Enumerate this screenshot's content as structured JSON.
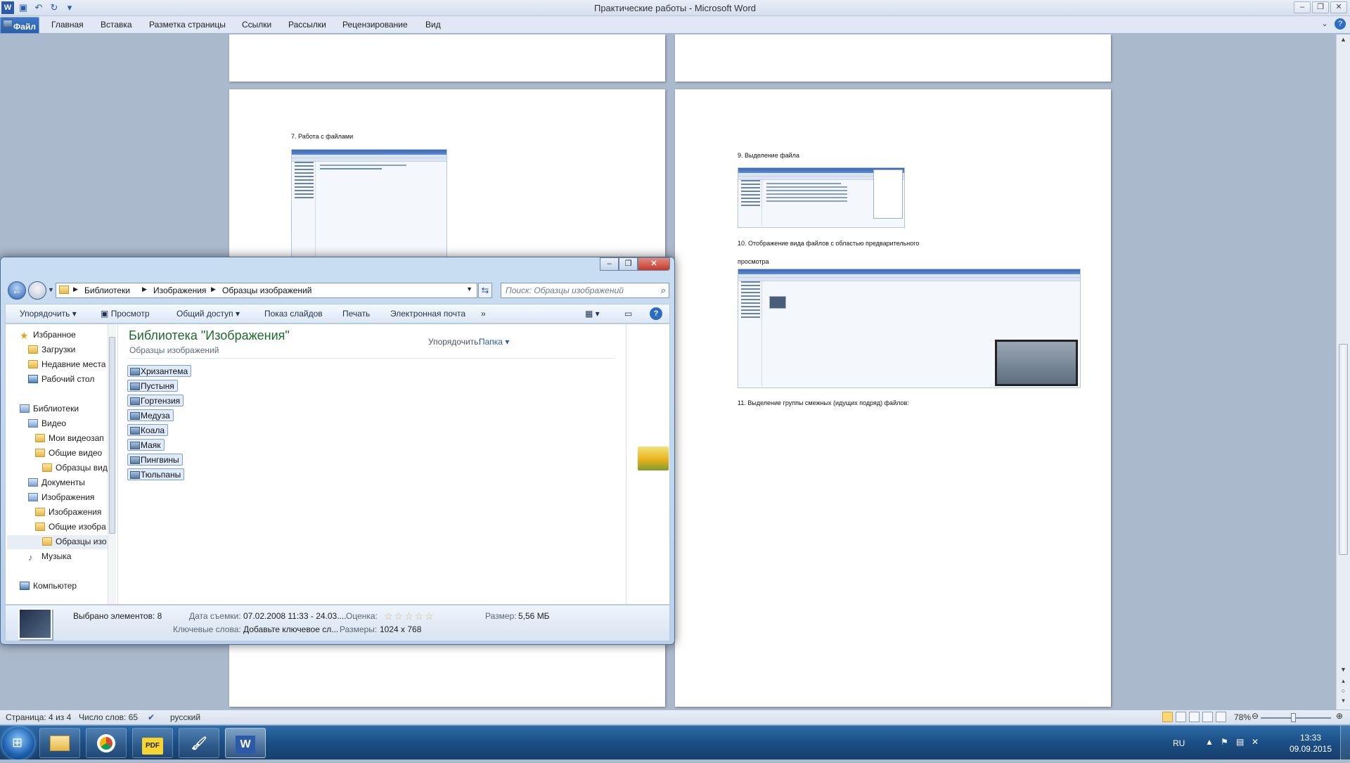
{
  "word": {
    "window_title": "Практические  работы  -  Microsoft Word",
    "file_tab": "Файл",
    "tabs": [
      "Главная",
      "Вставка",
      "Разметка страницы",
      "Ссылки",
      "Рассылки",
      "Рецензирование",
      "Вид"
    ]
  },
  "document": {
    "left_page": {
      "heading": "7. Работа с файлами"
    },
    "right_page": {
      "item9": "9. Выделение файла",
      "item10_line1": "10. Отображение вида файлов с областью предварительного",
      "item10_line2": "просмотра",
      "item11": "11. Выделение группы смежных (идущих подряд) файлов:"
    }
  },
  "statusbar": {
    "page": "Страница: 4 из 4",
    "words": "Число слов: 65",
    "language": "русский",
    "zoom": "78%",
    "zoom_level": 0.78
  },
  "explorer": {
    "breadcrumbs": [
      "Библиотеки",
      "Изображения",
      "Образцы изображений"
    ],
    "search_placeholder": "Поиск: Образцы изображений",
    "commands": [
      "Упорядочить",
      "Просмотр",
      "Общий доступ",
      "Показ слайдов",
      "Печать",
      "Электронная почта"
    ],
    "more": "»",
    "nav": {
      "favorites": "Избранное",
      "downloads": "Загрузки",
      "recent": "Недавние места",
      "desktop": "Рабочий стол",
      "libraries": "Библиотеки",
      "video": "Видео",
      "my_video": "Мои видеозап",
      "public_video": "Общие видео",
      "sample_video": "Образцы вид",
      "documents": "Документы",
      "images": "Изображения",
      "my_images": "Изображения",
      "public_images": "Общие изобра",
      "sample_images": "Образцы изо",
      "music": "Музыка",
      "computer": "Компьютер"
    },
    "library_title": "Библиотека \"Изображения\"",
    "library_subtitle": "Образцы изображений",
    "arrange_label": "Упорядочить:",
    "arrange_value": "Папка",
    "files": [
      "Хризантема",
      "Пустыня",
      "Гортензия",
      "Медуза",
      "Коала",
      "Маяк",
      "Пингвины",
      "Тюльпаны"
    ],
    "details": {
      "selected": "Выбрано элементов: 8",
      "date_label": "Дата съемки:",
      "date_value": "07.02.2008 11:33 - 24.03....",
      "rating_label": "Оценка:",
      "size_label": "Размер:",
      "size_value": "5,56 МБ",
      "keywords_label": "Ключевые слова:",
      "keywords_value": "Добавьте ключевое сл...",
      "dims_label": "Размеры:",
      "dims_value": "1024 x 768"
    }
  },
  "taskbar": {
    "apps": [
      "explorer-app",
      "chrome-app",
      "pdf-app",
      "paint-app",
      "word-app"
    ],
    "lang": "RU",
    "time": "13:33",
    "date": "09.09.2015"
  }
}
